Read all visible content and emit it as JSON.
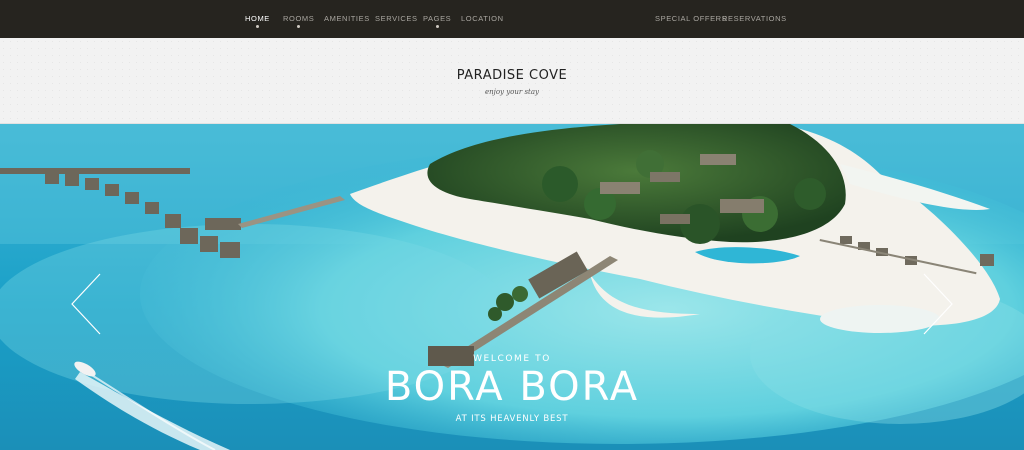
{
  "nav": {
    "left": [
      {
        "label": "HOME",
        "active": true,
        "has_submenu": true
      },
      {
        "label": "ROOMS",
        "active": false,
        "has_submenu": true
      },
      {
        "label": "AMENITIES",
        "active": false,
        "has_submenu": false
      },
      {
        "label": "SERVICES",
        "active": false,
        "has_submenu": false
      },
      {
        "label": "PAGES",
        "active": false,
        "has_submenu": true
      },
      {
        "label": "LOCATION",
        "active": false,
        "has_submenu": false
      }
    ],
    "right": [
      {
        "label": "SPECIAL OFFERS"
      },
      {
        "label": "RESERVATIONS"
      }
    ]
  },
  "brand": {
    "title": "PARADISE COVE",
    "tagline": "enjoy your stay"
  },
  "hero": {
    "welcome": "WELCOME TO",
    "headline": "BORA BORA",
    "subline": "AT ITS HEAVENLY BEST",
    "prev_icon": "chevron-left-icon",
    "next_icon": "chevron-right-icon"
  },
  "colors": {
    "nav_bg": "#26241f",
    "band_bg": "#f2f2f2",
    "sea_deep": "#1f9bc2",
    "lagoon": "#6fd6e0",
    "sand": "#f4f2ec",
    "foliage": "#2d5a2a"
  }
}
